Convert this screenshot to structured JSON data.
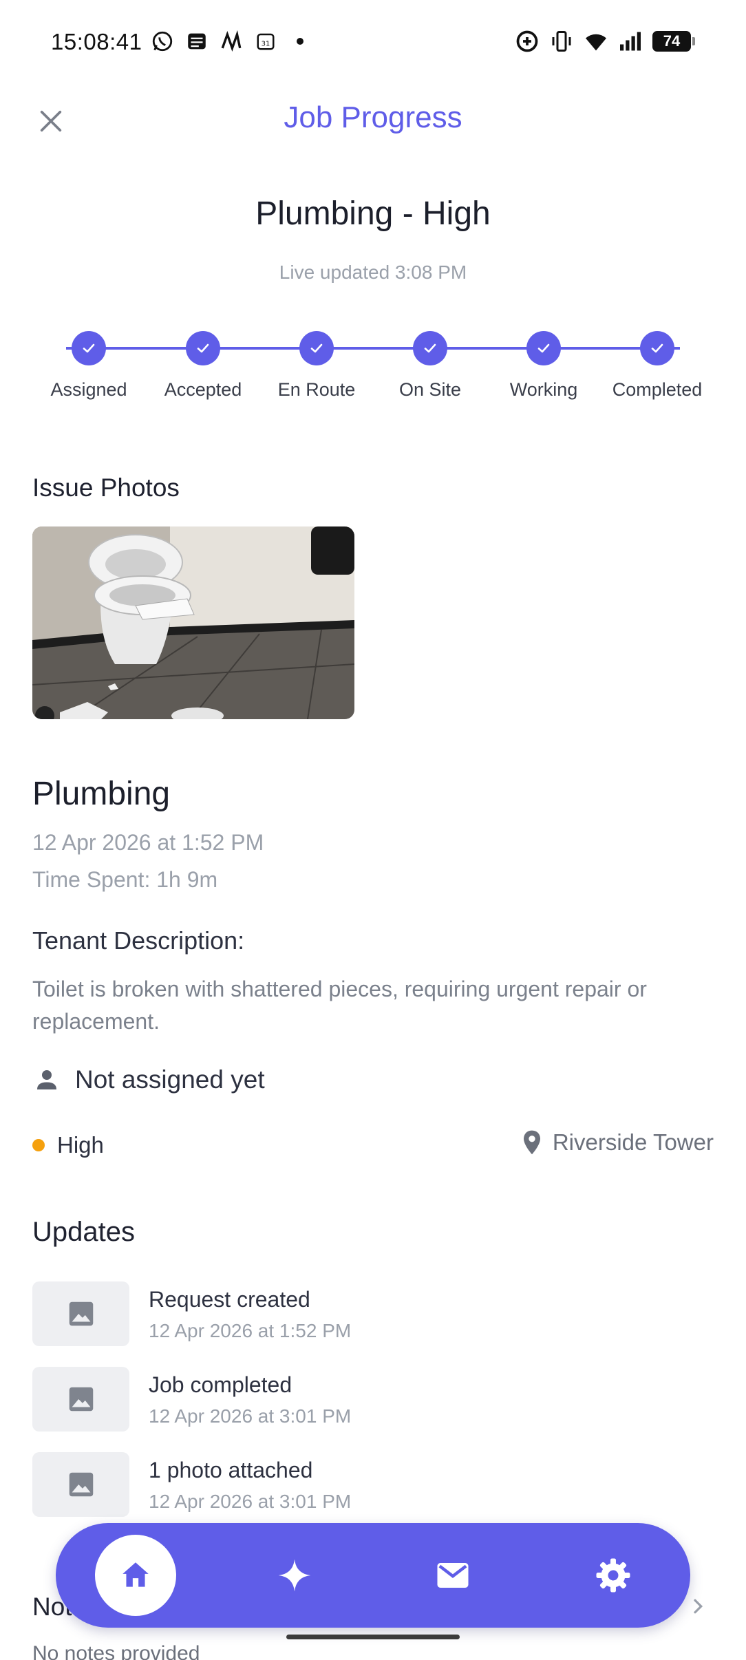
{
  "status_bar": {
    "time": "15:08:41",
    "battery": "74",
    "left_icons": [
      "whatsapp-icon",
      "app-icon",
      "app-icon",
      "calendar-icon",
      "dot-icon"
    ],
    "right_icons": [
      "data-saver-icon",
      "vibrate-icon",
      "wifi-icon",
      "signal-icon",
      "battery-icon"
    ]
  },
  "header": {
    "title": "Job Progress",
    "close_icon": "close-icon"
  },
  "job": {
    "title": "Plumbing - High",
    "live_updated": "Live updated 3:08 PM"
  },
  "progress": {
    "steps": [
      {
        "label": "Assigned",
        "done": true
      },
      {
        "label": "Accepted",
        "done": true
      },
      {
        "label": "En Route",
        "done": true
      },
      {
        "label": "On Site",
        "done": true
      },
      {
        "label": "Working",
        "done": true
      },
      {
        "label": "Completed",
        "done": true
      }
    ]
  },
  "photos": {
    "heading": "Issue Photos"
  },
  "request": {
    "category": "Plumbing",
    "date": "12 Apr 2026 at 1:52 PM",
    "time_spent": "Time Spent: 1h 9m",
    "description_label": "Tenant Description:",
    "description": "Toilet is broken with shattered pieces, requiring urgent repair or replacement.",
    "assignee": "Not assigned yet",
    "priority": "High",
    "location": "Riverside Tower"
  },
  "updates": {
    "heading": "Updates",
    "items": [
      {
        "title": "Request created",
        "date": "12 Apr 2026 at 1:52 PM"
      },
      {
        "title": "Job completed",
        "date": "12 Apr 2026 at 3:01 PM"
      },
      {
        "title": "1 photo attached",
        "date": "12 Apr 2026 at 3:01 PM"
      }
    ]
  },
  "notes": {
    "heading": "Notes",
    "text": "No notes provided"
  },
  "colors": {
    "accent": "#5f5de8",
    "priority_high": "#f5a00e"
  },
  "nav": {
    "items": [
      "home-icon",
      "sparkle-icon",
      "mail-icon",
      "settings-icon"
    ],
    "active": "home-icon"
  }
}
